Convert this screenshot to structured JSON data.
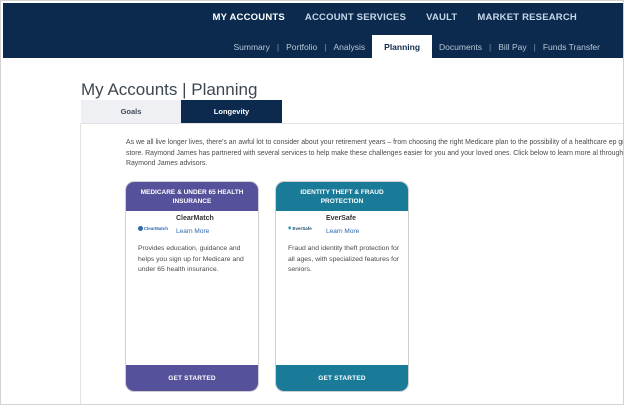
{
  "primary_nav": [
    {
      "label": "MY ACCOUNTS",
      "active": true
    },
    {
      "label": "ACCOUNT SERVICES",
      "active": false
    },
    {
      "label": "VAULT",
      "active": false
    },
    {
      "label": "MARKET RESEARCH",
      "active": false
    }
  ],
  "secondary_nav": [
    {
      "label": "Summary"
    },
    {
      "label": "Portfolio"
    },
    {
      "label": "Analysis"
    },
    {
      "label": "Planning",
      "active": true
    },
    {
      "label": "Documents"
    },
    {
      "label": "Bill Pay"
    },
    {
      "label": "Funds Transfer"
    }
  ],
  "page": {
    "title": "My Accounts | Planning"
  },
  "tabs": [
    {
      "label": "Goals",
      "active": false
    },
    {
      "label": "Longevity",
      "active": true
    }
  ],
  "intro_text": "As we all live longer lives, there's an awful lot to consider about your retirement years – from choosing the right Medicare plan to the possibility of a healthcare ep grocery store. Raymond James has partnered with several services to help make these challenges easier for you and your loved ones. Click below to learn more al through Raymond James advisors.",
  "cards": [
    {
      "header": "MEDICARE & UNDER 65 HEALTH INSURANCE",
      "logo_text": "ClearMatch",
      "brand_name": "ClearMatch",
      "learn_more": "Learn More",
      "description": "Provides education, guidance and helps you sign up for Medicare and under 65 health insurance.",
      "cta": "GET STARTED",
      "color": "#56519b"
    },
    {
      "header": "IDENTITY THEFT & FRAUD PROTECTION",
      "logo_text": "EverSafe",
      "brand_name": "EverSafe",
      "learn_more": "Learn More",
      "description": "Fraud and identity theft protection for all ages, with specialized features for seniors.",
      "cta": "GET STARTED",
      "color": "#1a7b99"
    }
  ],
  "colors": {
    "nav_bg": "#0c2a4d",
    "medicare": "#56519b",
    "identity": "#1a7b99",
    "link": "#2f68b0"
  }
}
